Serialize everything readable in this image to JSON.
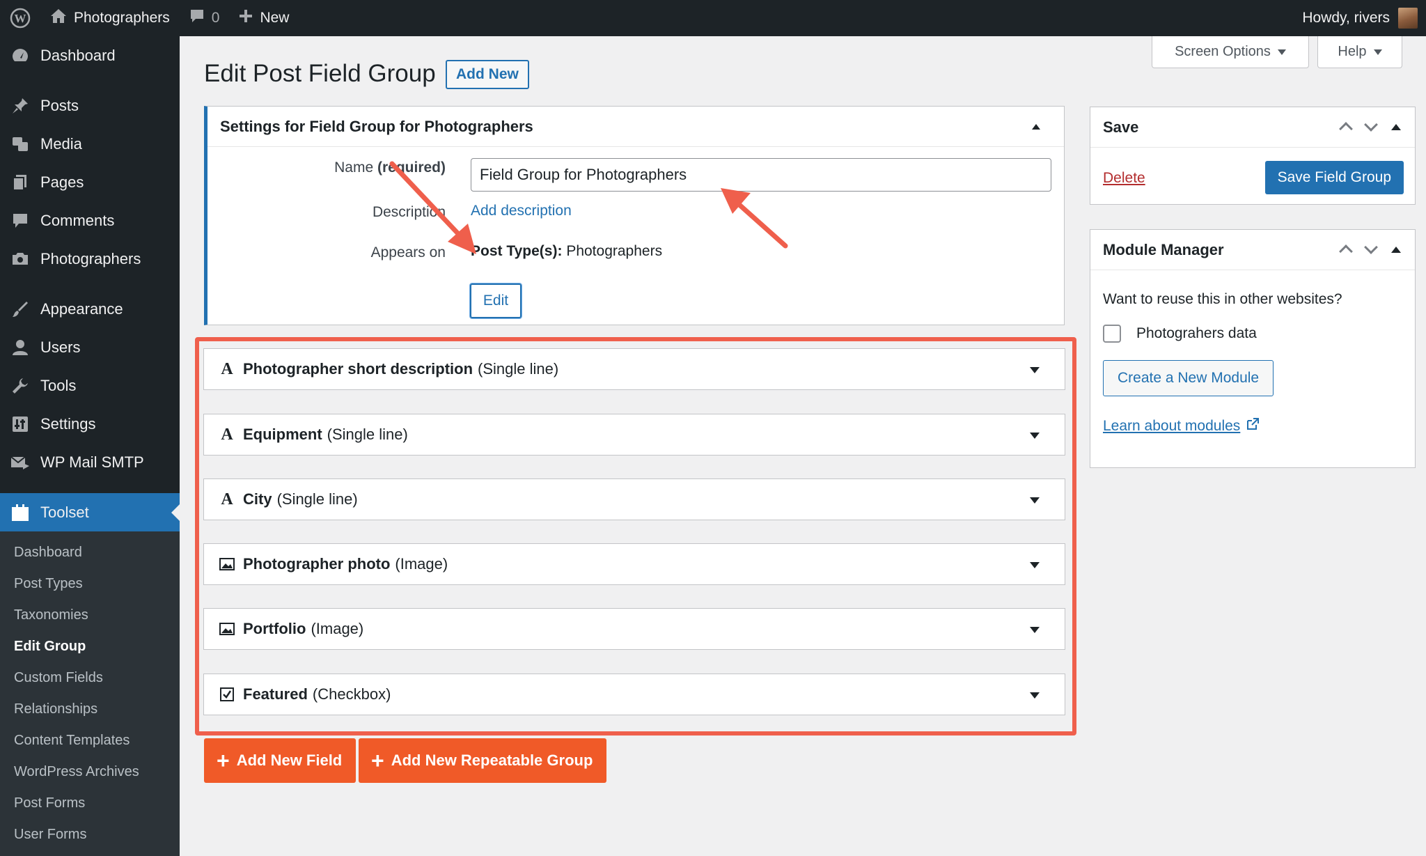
{
  "admin_bar": {
    "site_name": "Photographers",
    "comments_count": "0",
    "new_label": "New",
    "greeting": "Howdy, rivers"
  },
  "sidebar": {
    "items": [
      {
        "label": "Dashboard",
        "icon": "dashboard-icon"
      },
      {
        "label": "Posts",
        "icon": "pin-icon"
      },
      {
        "label": "Media",
        "icon": "media-icon"
      },
      {
        "label": "Pages",
        "icon": "pages-icon"
      },
      {
        "label": "Comments",
        "icon": "comment-icon"
      },
      {
        "label": "Photographers",
        "icon": "camera-icon"
      },
      {
        "label": "Appearance",
        "icon": "brush-icon"
      },
      {
        "label": "Users",
        "icon": "user-icon"
      },
      {
        "label": "Tools",
        "icon": "wrench-icon"
      },
      {
        "label": "Settings",
        "icon": "sliders-icon"
      },
      {
        "label": "WP Mail SMTP",
        "icon": "mail-icon"
      },
      {
        "label": "Toolset",
        "icon": "toolset-icon"
      }
    ],
    "submenu": [
      "Dashboard",
      "Post Types",
      "Taxonomies",
      "Edit Group",
      "Custom Fields",
      "Relationships",
      "Content Templates",
      "WordPress Archives",
      "Post Forms",
      "User Forms"
    ]
  },
  "header": {
    "screen_options": "Screen Options",
    "help": "Help",
    "title": "Edit Post Field Group",
    "add_new": "Add New"
  },
  "settings": {
    "title": "Settings for Field Group for Photographers",
    "name_label": "Name",
    "name_required": "(required)",
    "name_value": "Field Group for Photographers",
    "description_label": "Description",
    "add_description": "Add description",
    "appears_on_label": "Appears on",
    "post_types_label": "Post Type(s):",
    "post_types_value": "Photographers",
    "edit_button": "Edit"
  },
  "fields": [
    {
      "name": "Photographer short description",
      "type": "(Single line)",
      "icon": "text-icon"
    },
    {
      "name": "Equipment",
      "type": "(Single line)",
      "icon": "text-icon"
    },
    {
      "name": "City",
      "type": "(Single line)",
      "icon": "text-icon"
    },
    {
      "name": "Photographer photo",
      "type": "(Image)",
      "icon": "image-icon"
    },
    {
      "name": "Portfolio",
      "type": "(Image)",
      "icon": "image-icon"
    },
    {
      "name": "Featured",
      "type": "(Checkbox)",
      "icon": "checkbox-icon"
    }
  ],
  "actions": {
    "add_new_field": "Add New Field",
    "add_new_repeatable_group": "Add New Repeatable Group"
  },
  "save_box": {
    "title": "Save",
    "delete": "Delete",
    "save_button": "Save Field Group"
  },
  "module_manager": {
    "title": "Module Manager",
    "question": "Want to reuse this in other websites?",
    "checkbox_label": "Photograhers data",
    "create_button": "Create a New Module",
    "learn_link": "Learn about modules"
  },
  "colors": {
    "admin_dark": "#1d2327",
    "accent_blue": "#2271b1",
    "highlight_red": "#ef5f4c",
    "action_orange": "#f05a28",
    "delete_red": "#b32d2e"
  }
}
